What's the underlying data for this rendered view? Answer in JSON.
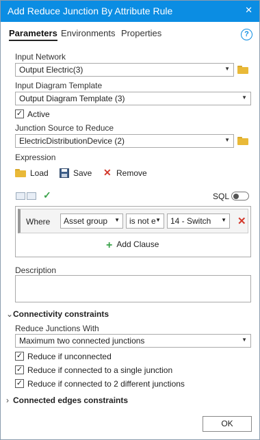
{
  "window": {
    "title": "Add Reduce Junction By Attribute Rule"
  },
  "tabs": [
    "Parameters",
    "Environments",
    "Properties"
  ],
  "input_network": {
    "label": "Input Network",
    "value": "Output Electric(3)"
  },
  "diagram_template": {
    "label": "Input Diagram Template",
    "value": "Output Diagram Template (3)"
  },
  "active": {
    "label": "Active",
    "checked": true
  },
  "junction_source": {
    "label": "Junction Source to Reduce",
    "value": "ElectricDistributionDevice (2)"
  },
  "expression": {
    "label": "Expression",
    "load": "Load",
    "save": "Save",
    "remove": "Remove",
    "sql_label": "SQL",
    "clause": {
      "where": "Where",
      "field": "Asset group",
      "operator": "is not e",
      "value": "14 - Switch"
    },
    "add_clause": "Add Clause"
  },
  "description": {
    "label": "Description",
    "value": ""
  },
  "connectivity": {
    "title": "Connectivity constraints",
    "reduce_with_label": "Reduce Junctions With",
    "reduce_with_value": "Maximum two connected junctions",
    "options": [
      {
        "label": "Reduce if unconnected",
        "checked": true
      },
      {
        "label": "Reduce if connected to a single junction",
        "checked": true
      },
      {
        "label": "Reduce if connected to 2 different junctions",
        "checked": true
      }
    ]
  },
  "edges_constraints": {
    "title": "Connected edges constraints"
  },
  "ok_label": "OK",
  "colors": {
    "titlebar": "#0b8de3",
    "remove_x": "#d3382b",
    "add_plus": "#3aa24a"
  }
}
